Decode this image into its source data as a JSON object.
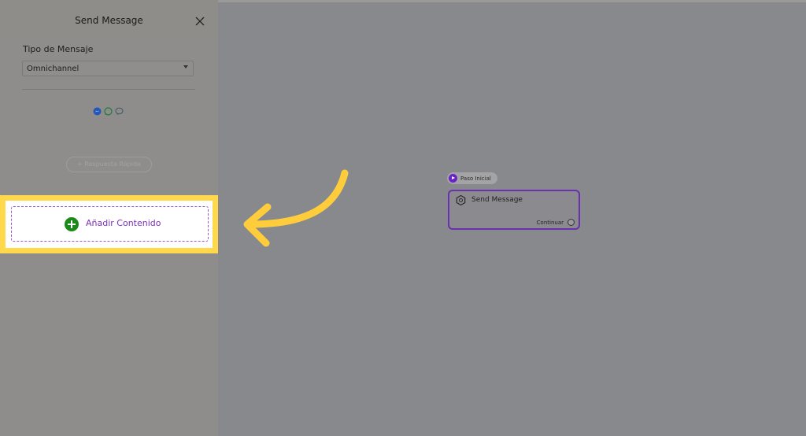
{
  "panel": {
    "title": "Send Message",
    "message_type_label": "Tipo de Mensaje",
    "message_type_value": "Omnichannel",
    "channels": [
      "messenger-icon",
      "whatsapp-icon",
      "chat-icon"
    ],
    "ghost_button_label": "+ Respuesta Rápida",
    "add_content_label": "Añadir Contenido"
  },
  "canvas": {
    "start_badge": "Paso Inicial",
    "node": {
      "title": "Send Message",
      "output_label": "Continuar"
    }
  },
  "colors": {
    "accent": "#7b2fbe",
    "highlight": "#ffd84c",
    "add_icon": "#1a8a1a",
    "node_border": "#6a30b0"
  }
}
